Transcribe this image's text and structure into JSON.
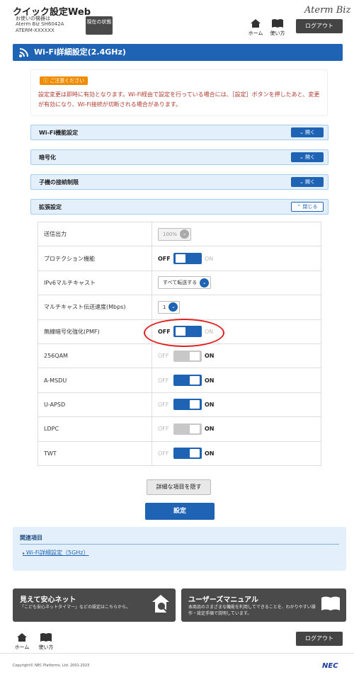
{
  "header": {
    "app_title": "クイック設定Web",
    "device_label": "お使いの機器は",
    "device_model": "Aterm Biz SH6042A",
    "device_id": "ATERM-XXXXXX",
    "status_button": "現在の状態",
    "brand": "Aterm Biz",
    "home_label": "ホーム",
    "guide_label": "使い方",
    "logout_label": "ログアウト"
  },
  "page_title": "Wi-Fi詳細設定(2.4GHz)",
  "notice": {
    "badge": "ご注意ください",
    "text": "設定変更は即時に有効となります。Wi-Fi経由で設定を行っている場合には、［設定］ボタンを押したあと、変更が有効になり、Wi-Fi接続が切断される場合があります。"
  },
  "sections": [
    {
      "label": "Wi-Fi機能設定",
      "button": "開く"
    },
    {
      "label": "暗号化",
      "button": "開く"
    },
    {
      "label": "子機の接続制限",
      "button": "開く"
    },
    {
      "label": "拡張設定",
      "button": "閉じる"
    }
  ],
  "rows": [
    {
      "label": "送信出力",
      "select": "100%"
    },
    {
      "label": "プロテクション機能",
      "off": "OFF",
      "on": "ON",
      "state": "off"
    },
    {
      "label": "IPv6マルチキャスト",
      "select": "すべて転送する"
    },
    {
      "label": "マルチキャスト伝送速度(Mbps)",
      "select": "1"
    },
    {
      "label": "無線暗号化強化(PMF)",
      "off": "OFF",
      "on": "ON",
      "state": "off"
    },
    {
      "label": "256QAM",
      "off": "OFF",
      "on": "ON",
      "state": "on-disabled"
    },
    {
      "label": "A-MSDU",
      "off": "OFF",
      "on": "ON",
      "state": "on"
    },
    {
      "label": "U-APSD",
      "off": "OFF",
      "on": "ON",
      "state": "on"
    },
    {
      "label": "LDPC",
      "off": "OFF",
      "on": "ON",
      "state": "on-disabled"
    },
    {
      "label": "TWT",
      "off": "OFF",
      "on": "ON",
      "state": "on"
    }
  ],
  "buttons": {
    "hide_details": "詳細な項目を隠す",
    "apply": "設定"
  },
  "related": {
    "title": "関連項目",
    "link": "Wi-Fi詳細設定（5GHz）"
  },
  "banners": {
    "left_title": "見えて安心ネット",
    "left_desc": "「こども安心ネットタイマー」などの設定はこちらから。",
    "right_title": "ユーザーズマニュアル",
    "right_desc": "本商品のさまざまな機能を利用してできることを、わかりやすい操作・設定手順で説明しています。"
  },
  "footer": {
    "copyright": "Copyright© NEC Platforms, Ltd. 2001-2023",
    "logo": "NEC"
  },
  "colors": {
    "accent": "#1f64b4",
    "notice_text": "#b03a2e",
    "highlight": "#e02020"
  }
}
